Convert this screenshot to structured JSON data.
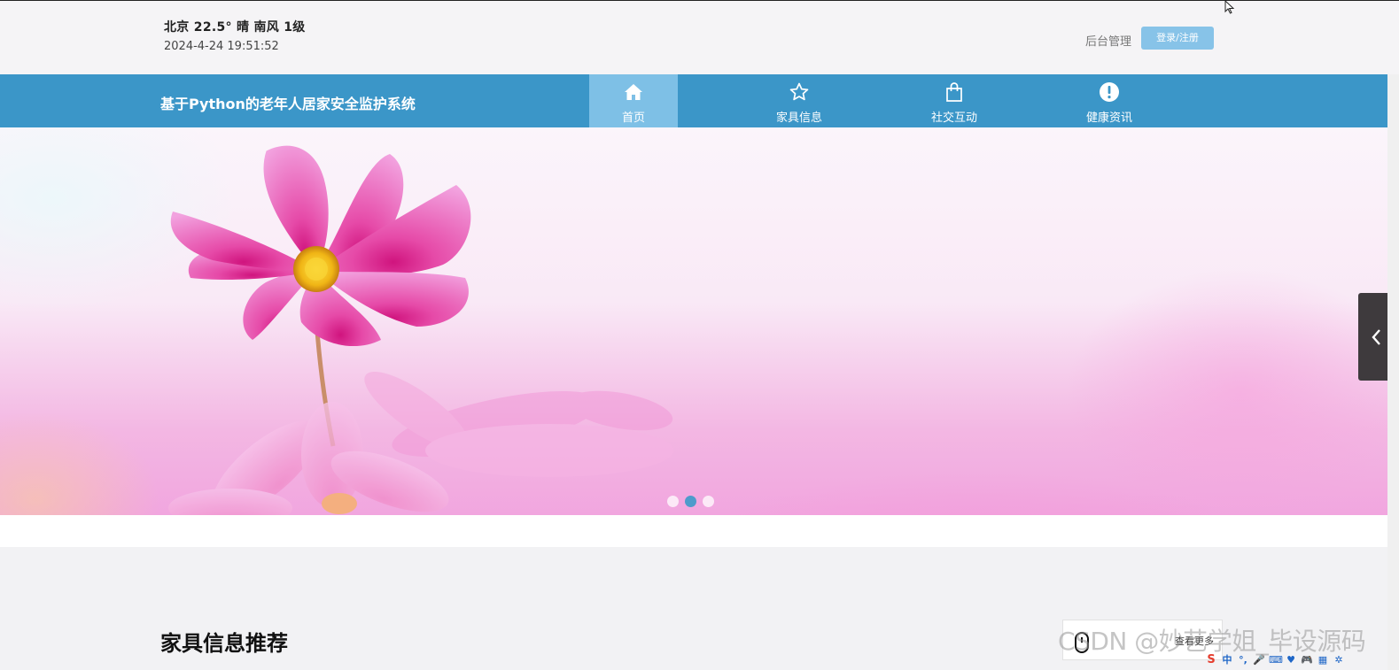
{
  "header": {
    "weather": "北京  22.5°  晴  南风  1级",
    "datetime": "2024-4-24 19:51:52",
    "admin_link": "后台管理",
    "login_button": "登录/注册"
  },
  "navbar": {
    "title": "基于Python的老年人居家安全监护系统",
    "items": [
      {
        "label": "首页",
        "icon": "home-icon",
        "active": true
      },
      {
        "label": "家具信息",
        "icon": "star-icon",
        "active": false
      },
      {
        "label": "社交互动",
        "icon": "shopping-bag-icon",
        "active": false
      },
      {
        "label": "健康资讯",
        "icon": "exclamation-circle-icon",
        "active": false
      }
    ]
  },
  "banner": {
    "slide_count": 3,
    "active_slide": 2
  },
  "section": {
    "title": "家具信息推荐"
  },
  "more_button": {
    "label": "查看更多"
  },
  "watermark": {
    "text": "CSDN @妙艺学姐_毕设源码"
  },
  "ime_toolbar": {
    "items": [
      "S",
      "中",
      "°,",
      "🎤",
      "⌨",
      "♥",
      "🎮",
      "▦",
      "✲"
    ]
  },
  "colors": {
    "navbar": "#3b96c8",
    "nav_active": "#7ec0e6",
    "login_button": "#87c3e8",
    "dot_active": "#4e9bcb"
  }
}
